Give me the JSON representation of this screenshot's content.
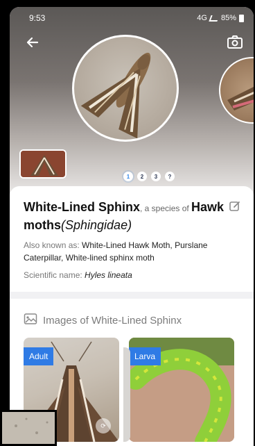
{
  "status": {
    "time": "9:53",
    "network": "4G",
    "battery": "85%"
  },
  "pager": {
    "pages": [
      "1",
      "2",
      "3",
      "?"
    ],
    "active": 0
  },
  "species": {
    "name": "White-Lined Sphinx",
    "connector": ", a species of ",
    "family": "Hawk moths",
    "family_sci": "(Sphingidae)",
    "aka_label": "Also known as: ",
    "aka_value": "White-Lined Hawk Moth, Purslane Caterpillar, White-lined sphinx moth",
    "sci_label": "Scientific name: ",
    "sci_value": "Hyles lineata"
  },
  "images": {
    "heading": "Images of White-Lined Sphinx",
    "cards": [
      {
        "tag": "Adult"
      },
      {
        "tag": "Larva"
      }
    ]
  },
  "colors": {
    "accent": "#2f7be5"
  },
  "icons": [
    "back-arrow-icon",
    "camera-icon",
    "edit-icon",
    "gallery-icon"
  ]
}
